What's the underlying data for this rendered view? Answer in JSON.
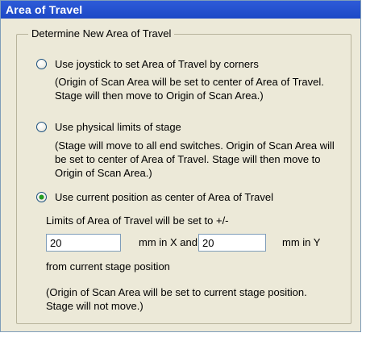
{
  "panel": {
    "title": "Area of Travel",
    "group_label": "Determine New Area of Travel"
  },
  "options": [
    {
      "label": "Use joystick to set Area of Travel by corners",
      "checked": false,
      "description": "(Origin of Scan Area will be set to center of Area of Travel. Stage will then move to Origin of Scan Area.)"
    },
    {
      "label": "Use physical limits of stage",
      "checked": false,
      "description": "(Stage will move to all end switches. Origin of Scan Area will be set to center of Area of Travel. Stage will then move to Origin of Scan Area.)"
    },
    {
      "label": "Use current position as center of Area of Travel",
      "checked": true
    }
  ],
  "limits": {
    "intro": "Limits of Area of Travel will be set to +/-",
    "x_value": "20",
    "x_unit": "mm in X and",
    "y_value": "20",
    "y_unit": "mm in Y",
    "from_text": "from current stage position",
    "note": "(Origin of Scan Area will be set to current stage position. Stage will not move.)"
  }
}
